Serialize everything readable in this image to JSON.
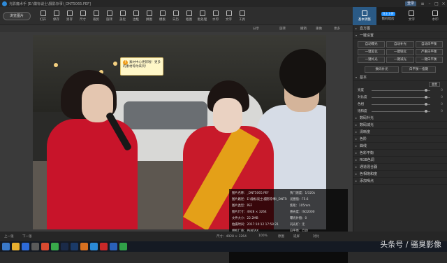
{
  "app": {
    "title": "光影魔术手 [E:\\徽标谈士\\摄影杂事\\_DNT5065.PEF]",
    "login": "登录"
  },
  "toolbar": {
    "browse_label": "浏览图片",
    "tools": [
      "打开",
      "保存",
      "另存",
      "尺寸",
      "裁剪",
      "旋转",
      "美化",
      "边框",
      "拼图",
      "模板",
      "日历",
      "抠图",
      "批处理",
      "水印",
      "文字",
      "工具"
    ]
  },
  "right_tabs": [
    {
      "label": "基本调整",
      "badge": ""
    },
    {
      "label": "数码暗房",
      "badge": "马上上传"
    },
    {
      "label": "文字",
      "badge": ""
    },
    {
      "label": "水印",
      "badge": ""
    }
  ],
  "subbar": {
    "share": "分享",
    "rotate": "旋转",
    "undo": "撤销",
    "redo": "重做",
    "more": "更多"
  },
  "tooltip": {
    "text": "素材中心更新啦！更多的素材等你来玩！"
  },
  "info_panel": {
    "rows": [
      [
        "图片名称：_DNT5065.PEF",
        "快门速度：1/320s"
      ],
      [
        "图片路径：E:\\徽标谈士\\摄影杂事\\_DNT506...",
        "光圈值：F5.6"
      ],
      [
        "图片类型：PEF",
        "焦距：105mm"
      ],
      [
        "图片尺寸：4928 × 3264",
        "感光度：ISO2000"
      ],
      [
        "文件大小：22.2MB",
        "曝光补偿：0"
      ],
      [
        "拍摄时间：2017:10:12 17:58:21",
        "闪光灯：无"
      ],
      [
        "相机厂商：PENTAX",
        "白平衡：自动"
      ],
      [
        "相机型号：K-5",
        "拍摄模式：手动"
      ],
      [
        "镜头机身：smc PENTAX-FA 100-300mm F4.5...",
        "测光模式：点测"
      ],
      [
        "拍门次数：41235",
        ""
      ]
    ]
  },
  "rpanel": {
    "histogram": "直方图",
    "oneclick": "一键设置",
    "oneclick_buttons": [
      "自动曝光",
      "自动补光",
      "自动白平衡",
      "一键美化",
      "一键锐化",
      "严重白平衡",
      "一键补光",
      "一键减光",
      "一键白平衡"
    ],
    "extra_buttons": [
      "数码补光",
      "白平衡一指键"
    ],
    "basic": "基本",
    "reset": "重置",
    "sliders": [
      {
        "label": "亮度",
        "value": "0"
      },
      {
        "label": "对比度",
        "value": "0"
      },
      {
        "label": "色相",
        "value": "0"
      },
      {
        "label": "饱和度",
        "value": "0"
      }
    ],
    "sections": [
      "数码补光",
      "数码减光",
      "清晰度",
      "色阶",
      "曲线",
      "色彩平衡",
      "RGB色调",
      "通道混合器",
      "色相饱和度",
      "添加噪点"
    ]
  },
  "bottombar": {
    "prev": "上一张",
    "next": "下一张",
    "size": "尺寸：4928 × 3264",
    "zoom": "100%",
    "original": "原图",
    "fit": "适屏",
    "compare": "对比"
  },
  "watermark": "头条号 / 骚臭影像"
}
